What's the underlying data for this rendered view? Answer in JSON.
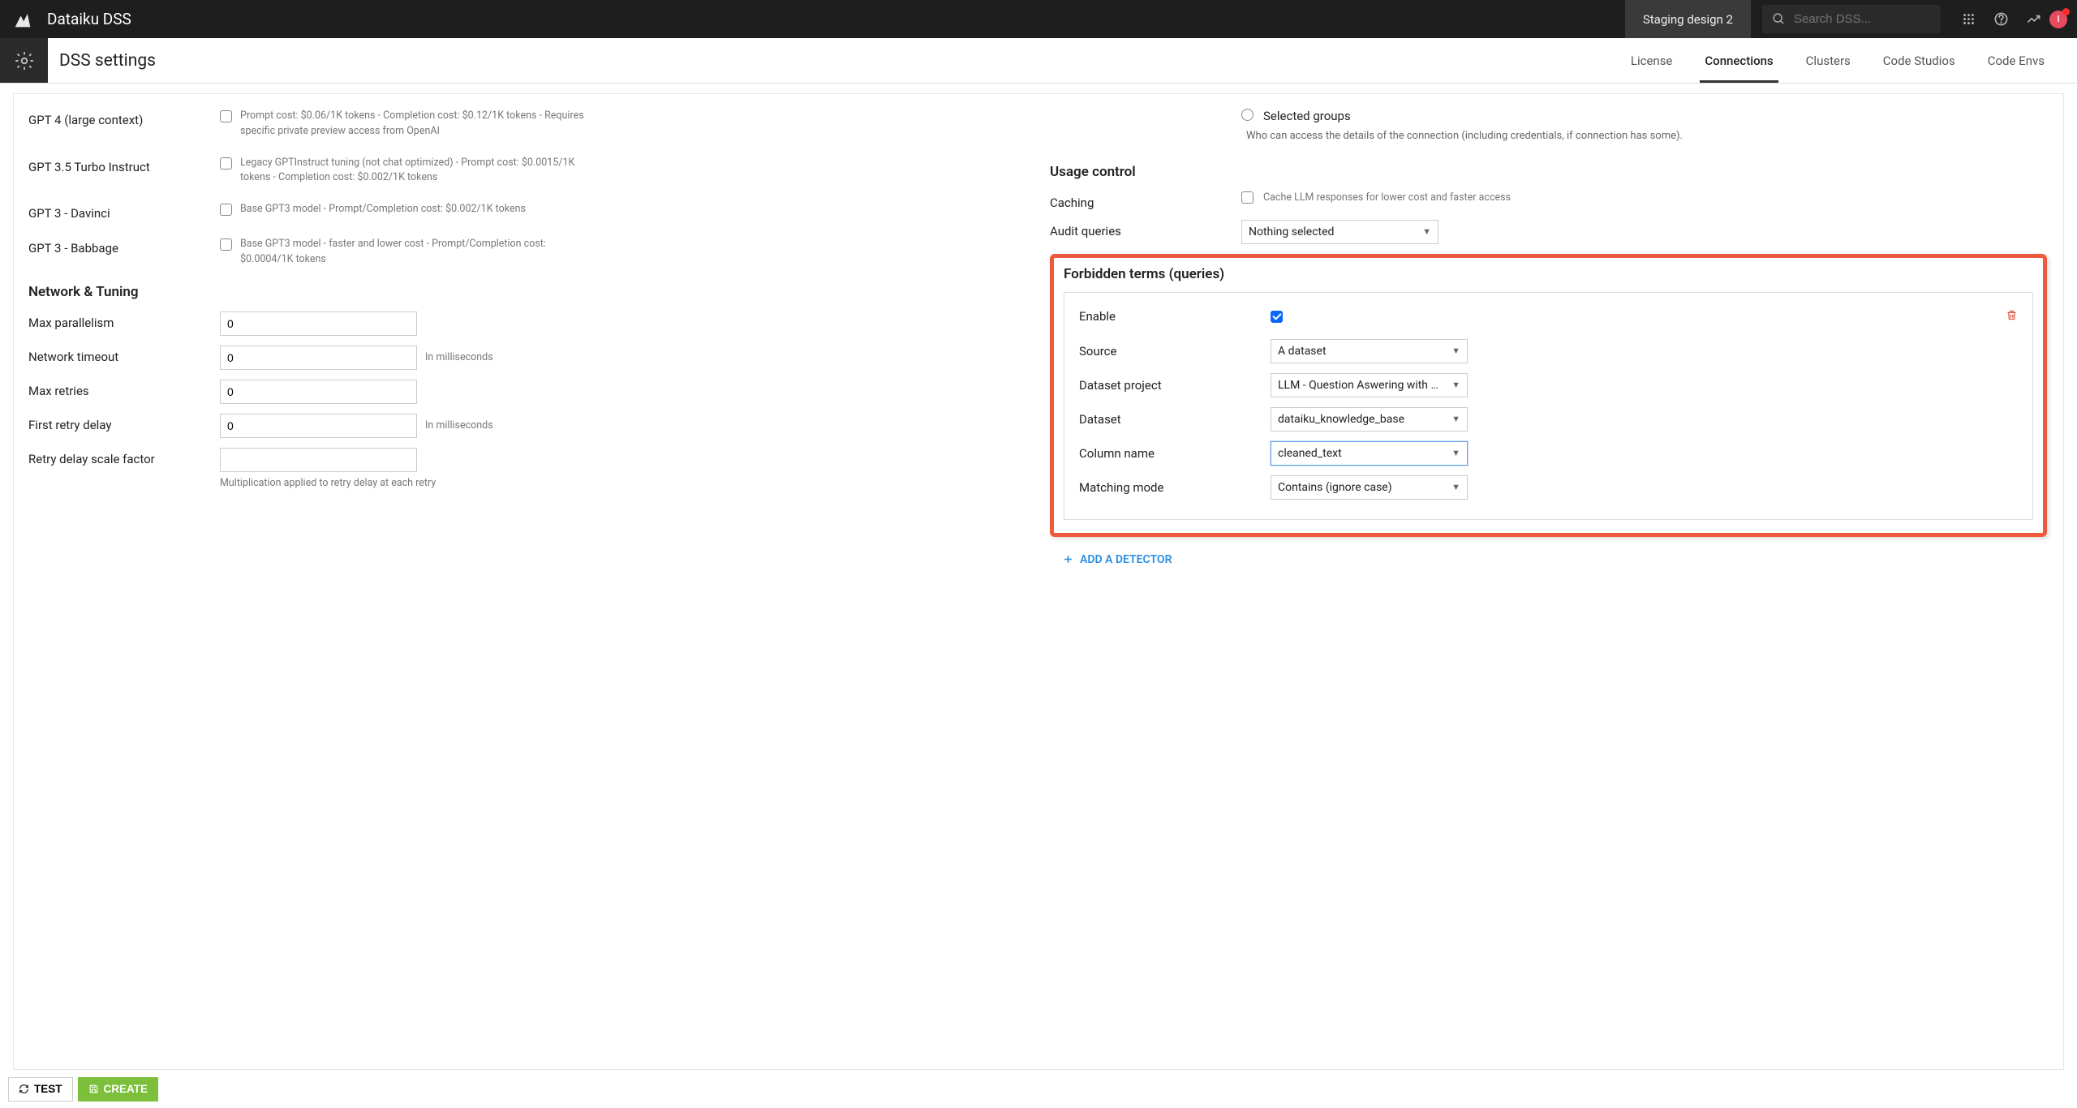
{
  "brand": "Dataiku DSS",
  "env_badge": "Staging design 2",
  "search_placeholder": "Search DSS...",
  "avatar_letter": "I",
  "page_title": "DSS settings",
  "tabs": [
    "License",
    "Connections",
    "Clusters",
    "Code Studios",
    "Code Envs"
  ],
  "active_tab": 1,
  "models": [
    {
      "name": "GPT 4 (large context)",
      "desc": "Prompt cost: $0.06/1K tokens - Completion cost: $0.12/1K tokens - Requires specific private preview access from OpenAI"
    },
    {
      "name": "GPT 3.5 Turbo Instruct",
      "desc": "Legacy GPTInstruct tuning (not chat optimized) - Prompt cost: $0.0015/1K tokens - Completion cost: $0.002/1K tokens"
    },
    {
      "name": "GPT 3 - Davinci",
      "desc": "Base GPT3 model - Prompt/Completion cost: $0.002/1K tokens"
    },
    {
      "name": "GPT 3 - Babbage",
      "desc": "Base GPT3 model - faster and lower cost - Prompt/Completion cost: $0.0004/1K tokens"
    }
  ],
  "network_tuning_title": "Network & Tuning",
  "network_fields": {
    "max_parallelism": {
      "label": "Max parallelism",
      "value": "0"
    },
    "network_timeout": {
      "label": "Network timeout",
      "value": "0",
      "hint": "In milliseconds"
    },
    "max_retries": {
      "label": "Max retries",
      "value": "0"
    },
    "first_retry_delay": {
      "label": "First retry delay",
      "value": "0",
      "hint": "In milliseconds"
    },
    "retry_scale": {
      "label": "Retry delay scale factor",
      "value": "",
      "hint_below": "Multiplication applied to retry delay at each retry"
    }
  },
  "selected_groups_label": "Selected groups",
  "selected_groups_desc": "Who can access the details of the connection (including credentials, if connection has some).",
  "usage_control_title": "Usage control",
  "caching_label": "Caching",
  "caching_desc": "Cache LLM responses for lower cost and faster access",
  "audit_label": "Audit queries",
  "audit_select": "Nothing selected",
  "forbidden_title": "Forbidden terms (queries)",
  "forbidden": {
    "enable_label": "Enable",
    "source_label": "Source",
    "source_value": "A dataset",
    "project_label": "Dataset project",
    "project_value": "LLM - Question Aswering with …",
    "dataset_label": "Dataset",
    "dataset_value": "dataiku_knowledge_base",
    "column_label": "Column name",
    "column_value": "cleaned_text",
    "matching_label": "Matching mode",
    "matching_value": "Contains (ignore case)"
  },
  "add_detector_label": "ADD A DETECTOR",
  "footer": {
    "test": "TEST",
    "create": "CREATE"
  }
}
